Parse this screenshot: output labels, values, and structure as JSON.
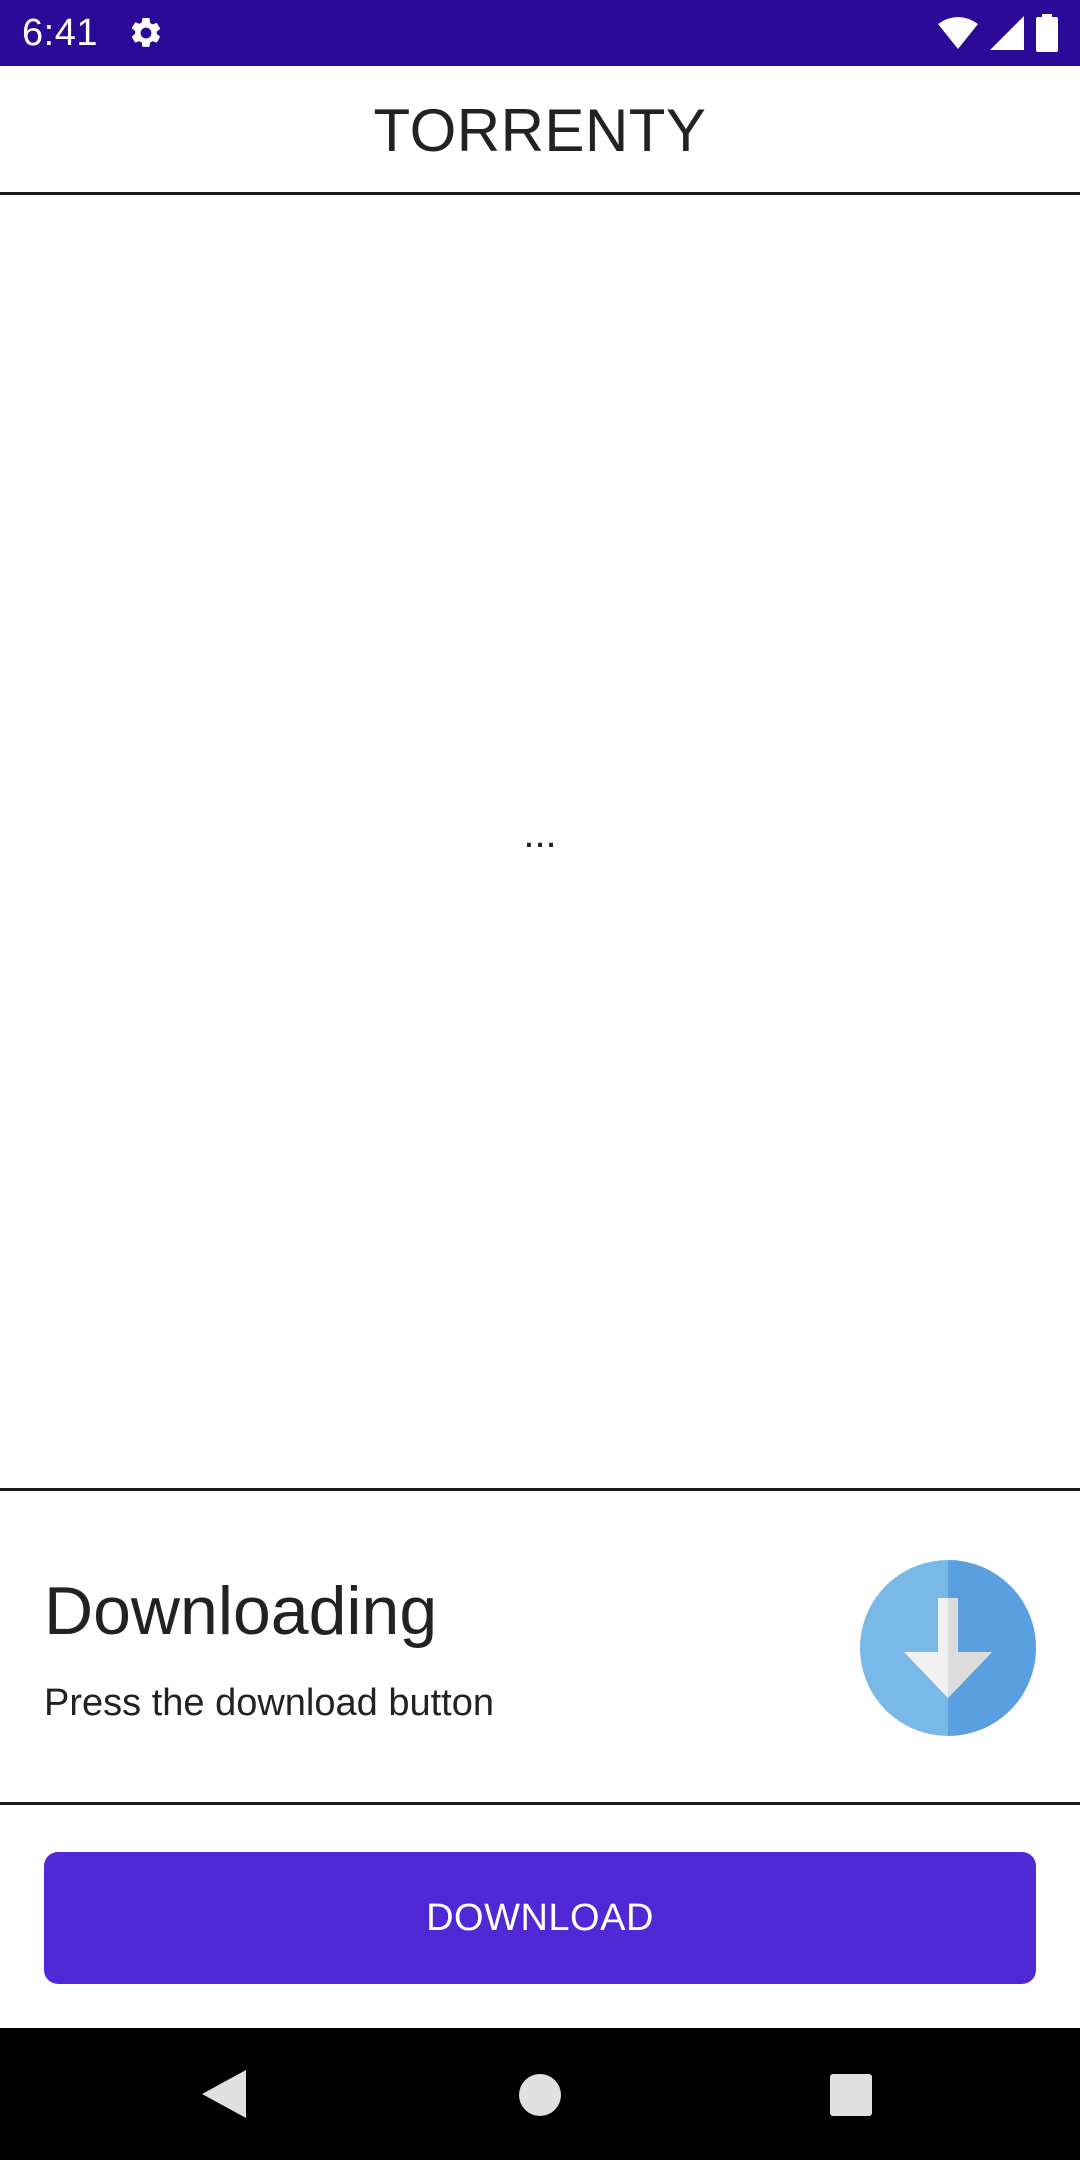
{
  "status_bar": {
    "time": "6:41",
    "icons": [
      "gear-icon",
      "wifi-icon",
      "signal-icon",
      "battery-icon"
    ],
    "background": "#2a0a96"
  },
  "app_bar": {
    "title": "TORRENTY"
  },
  "content": {
    "placeholder_text": "..."
  },
  "download_card": {
    "title": "Downloading",
    "subtitle": "Press the download button",
    "icon": "download-arrow-icon"
  },
  "actions": {
    "download_label": "DOWNLOAD",
    "accent_color": "#5028d6"
  },
  "nav_bar": {
    "icons": [
      "back-icon",
      "home-icon",
      "recents-icon"
    ]
  }
}
